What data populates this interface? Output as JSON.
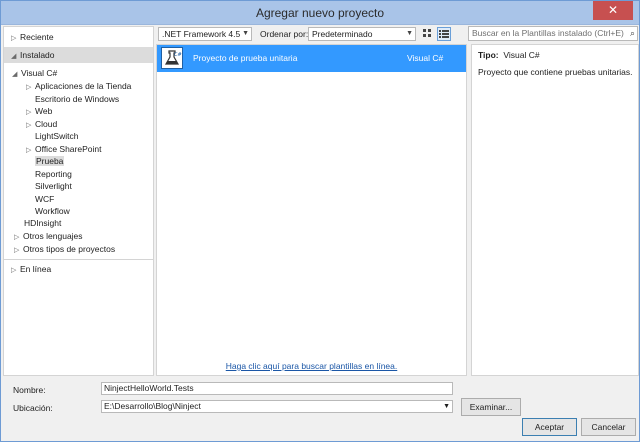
{
  "window": {
    "title": "Agregar nuevo proyecto",
    "close_glyph": "✕"
  },
  "left_panel": {
    "recent": "Reciente",
    "installed": "Instalado",
    "visual_csharp": "Visual C#",
    "csharp_children": [
      {
        "label": "Aplicaciones de la Tienda",
        "expandable": true
      },
      {
        "label": "Escritorio de Windows",
        "expandable": false
      },
      {
        "label": "Web",
        "expandable": true
      },
      {
        "label": "Cloud",
        "expandable": true
      },
      {
        "label": "LightSwitch",
        "expandable": false
      },
      {
        "label": "Office SharePoint",
        "expandable": true
      },
      {
        "label": "Prueba",
        "expandable": false,
        "selected": true
      },
      {
        "label": "Reporting",
        "expandable": false
      },
      {
        "label": "Silverlight",
        "expandable": false
      },
      {
        "label": "WCF",
        "expandable": false
      },
      {
        "label": "Workflow",
        "expandable": false
      }
    ],
    "hdinsight": "HDInsight",
    "other_languages": "Otros lenguajes",
    "other_project_types": "Otros tipos de proyectos",
    "online": "En línea"
  },
  "toolbar": {
    "framework": ".NET Framework 4.5",
    "sort_label": "Ordenar por:",
    "sort_value": "Predeterminado",
    "search_placeholder": "Buscar en la Plantillas instalado (Ctrl+E)"
  },
  "templates": [
    {
      "name": "Proyecto de prueba unitaria",
      "language": "Visual C#"
    }
  ],
  "online_link": "Haga clic aquí para buscar plantillas en línea.",
  "details": {
    "type_label": "Tipo:",
    "type_value": "Visual C#",
    "description": "Proyecto que contiene pruebas unitarias."
  },
  "form": {
    "name_label": "Nombre:",
    "name_value": "NinjectHelloWorld.Tests",
    "location_label": "Ubicación:",
    "location_value": "E:\\Desarrollo\\Blog\\Ninject",
    "browse": "Examinar...",
    "accept": "Aceptar",
    "cancel": "Cancelar"
  }
}
